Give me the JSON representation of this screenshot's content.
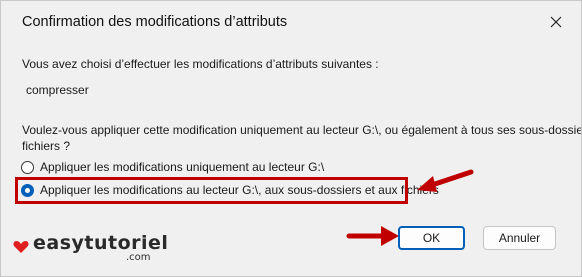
{
  "window": {
    "title": "Confirmation des modifications d’attributs"
  },
  "content": {
    "intro": "Vous avez choisi d’effectuer les modifications d’attributs suivantes :",
    "attribute": "compresser",
    "question_line1": "Voulez-vous appliquer cette modification uniquement au lecteur G:\\, ou également à tous ses sous-dossiers et",
    "question_line2": "fichiers ?"
  },
  "options": [
    {
      "label": "Appliquer les modifications uniquement au lecteur G:\\",
      "checked": false
    },
    {
      "label": "Appliquer les modifications au lecteur G:\\, aux sous-dossiers et aux fichiers",
      "checked": true
    }
  ],
  "buttons": {
    "ok": "OK",
    "cancel": "Annuler"
  },
  "watermark": {
    "brand": "easytutoriel",
    "domain": ".com"
  },
  "colors": {
    "accent": "#005fb8",
    "annotation": "#c00000"
  }
}
